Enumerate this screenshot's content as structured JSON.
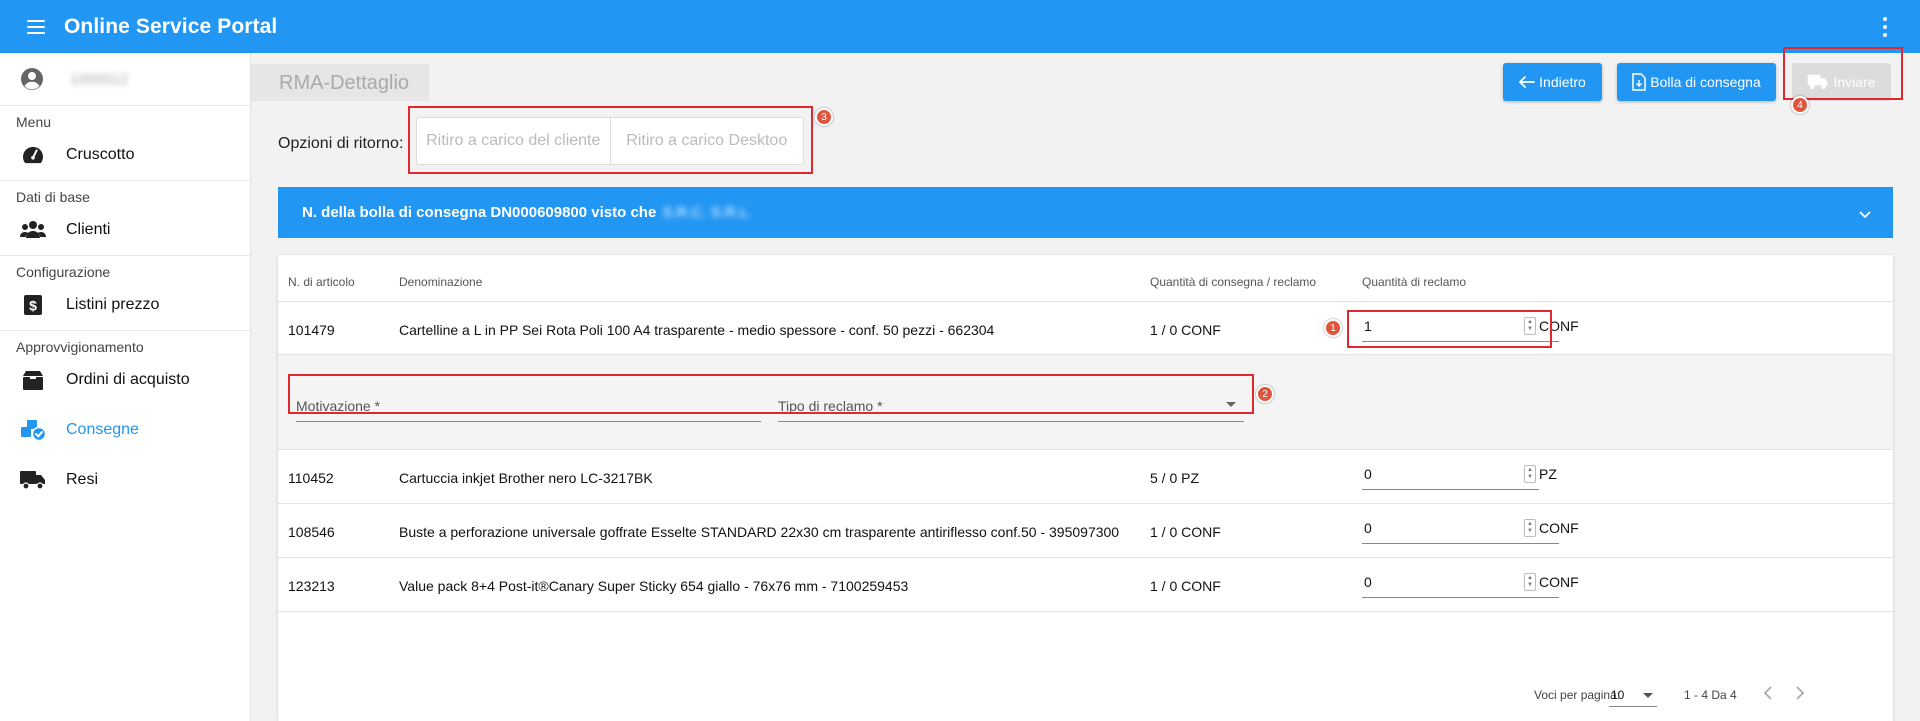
{
  "app": {
    "title": "Online Service Portal"
  },
  "user": {
    "name": "1000012"
  },
  "sidebar": {
    "sections": [
      {
        "title": "Menu",
        "items": [
          {
            "label": "Cruscotto",
            "icon": "speedometer-icon"
          }
        ]
      },
      {
        "title": "Dati di base",
        "items": [
          {
            "label": "Clienti",
            "icon": "users-icon"
          }
        ]
      },
      {
        "title": "Configurazione",
        "items": [
          {
            "label": "Listini prezzo",
            "icon": "dollar-icon"
          }
        ]
      },
      {
        "title": "Approvvigionamento",
        "items": [
          {
            "label": "Ordini di acquisto",
            "icon": "box-icon"
          },
          {
            "label": "Consegne",
            "icon": "boxes-check-icon",
            "active": true
          },
          {
            "label": "Resi",
            "icon": "truck-icon"
          }
        ]
      }
    ]
  },
  "page": {
    "title": "RMA-Dettaglio",
    "buttons": {
      "back": "Indietro",
      "delivery_note": "Bolla di consegna",
      "send": "Inviare"
    },
    "return_options": {
      "label": "Opzioni di ritorno:",
      "options": [
        "Ritiro a carico del cliente",
        "Ritiro a carico Desktoo"
      ]
    },
    "delivery_header": {
      "text": "N. della bolla di consegna DN000609800 visto che",
      "company": "S.R.C. S.R.L."
    },
    "badges": [
      "1",
      "2",
      "3",
      "4"
    ]
  },
  "table": {
    "columns": [
      "N. di articolo",
      "Denominazione",
      "Quantità di consegna / reclamo",
      "Quantità di reclamo"
    ],
    "rows": [
      {
        "article": "101479",
        "name": "Cartelline a L in PP Sei Rota Poli 100 A4 trasparente - medio spessore - conf. 50 pezzi - 662304",
        "delivery": "1 / 0 CONF",
        "qty": "1",
        "unit": "CONF"
      },
      {
        "article": "110452",
        "name": "Cartuccia inkjet Brother nero LC-3217BK",
        "delivery": "5 / 0 PZ",
        "qty": "0",
        "unit": "PZ"
      },
      {
        "article": "108546",
        "name": "Buste a perforazione universale goffrate Esselte STANDARD 22x30 cm trasparente antiriflesso conf.50 - 395097300",
        "delivery": "1 / 0 CONF",
        "qty": "0",
        "unit": "CONF"
      },
      {
        "article": "123213",
        "name": "Value pack 8+4 Post-it®Canary Super Sticky 654 giallo - 76x76 mm - 7100259453",
        "delivery": "1 / 0 CONF",
        "qty": "0",
        "unit": "CONF"
      }
    ],
    "expanded": {
      "reason_label": "Motivazione *",
      "type_label": "Tipo di reclamo *"
    }
  },
  "pagination": {
    "per_page_label": "Voci per pagina:",
    "per_page": "10",
    "range": "1 - 4 Da 4"
  },
  "colors": {
    "primary": "#2196f3",
    "highlight": "#e0292e",
    "badge": "#e0563d",
    "disabled": "#dcdcdc"
  }
}
